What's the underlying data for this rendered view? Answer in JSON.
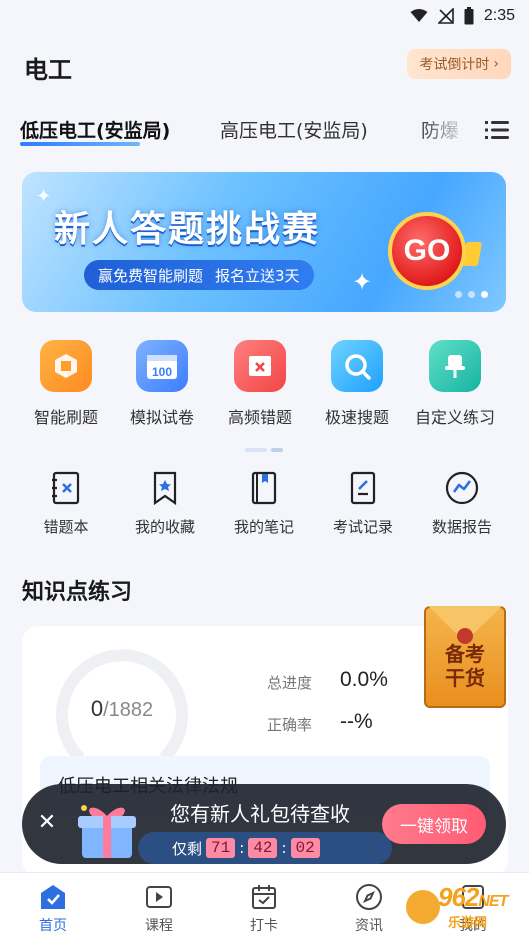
{
  "status_bar": {
    "time": "2:35"
  },
  "header": {
    "title": "电工",
    "countdown_label": "考试倒计时",
    "countdown_arrow": "›"
  },
  "tabs": [
    {
      "label": "低压电工(安监局)"
    },
    {
      "label": "高压电工(安监局)"
    },
    {
      "label": "防爆"
    }
  ],
  "banner": {
    "title": "新人答题挑战赛",
    "subtitle_a": "赢免费智能刷题",
    "subtitle_b": "报名立送3天",
    "go_label": "GO"
  },
  "features": [
    {
      "label": "智能刷题",
      "icon": "smart-practice-icon",
      "color": "#ff9d2e"
    },
    {
      "label": "模拟试卷",
      "icon": "mock-exam-icon",
      "color": "#4a8dff"
    },
    {
      "label": "高频错题",
      "icon": "frequent-mistakes-icon",
      "color": "#ff5a5a"
    },
    {
      "label": "极速搜题",
      "icon": "fast-search-icon",
      "color": "#2fb6ff"
    },
    {
      "label": "自定义练习",
      "icon": "custom-practice-icon",
      "color": "#2bc4b4"
    }
  ],
  "tools": [
    {
      "label": "错题本",
      "icon": "mistake-book-icon"
    },
    {
      "label": "我的收藏",
      "icon": "favorites-icon"
    },
    {
      "label": "我的笔记",
      "icon": "notes-icon"
    },
    {
      "label": "考试记录",
      "icon": "exam-record-icon"
    },
    {
      "label": "数据报告",
      "icon": "data-report-icon"
    }
  ],
  "knowledge": {
    "title": "知识点练习",
    "done": "0",
    "total": "/1882",
    "progress_label": "总进度",
    "progress_value": "0.0%",
    "accuracy_label": "正确率",
    "accuracy_value": "--%",
    "chapter_title": "低压电工相关法律法规"
  },
  "dry_goods": {
    "line1": "备考",
    "line2": "干货"
  },
  "gift": {
    "title": "您有新人礼包待查收",
    "remaining_label": "仅剩",
    "hours": "71",
    "minutes": "42",
    "seconds": "02",
    "claim_label": "一键领取",
    "close_glyph": "✕"
  },
  "bottom_nav": [
    {
      "label": "首页",
      "icon": "home-icon",
      "active": true
    },
    {
      "label": "课程",
      "icon": "course-icon",
      "active": false
    },
    {
      "label": "打卡",
      "icon": "checkin-icon",
      "active": false
    },
    {
      "label": "资讯",
      "icon": "news-icon",
      "active": false
    },
    {
      "label": "我的",
      "icon": "profile-icon",
      "active": false
    }
  ],
  "watermark": {
    "brand": "962",
    "domain": "NET",
    "sub": "乐游网"
  },
  "colors": {
    "accent": "#2e6fe0",
    "claim": "#ff5b74",
    "banner": "#47a7ff"
  }
}
